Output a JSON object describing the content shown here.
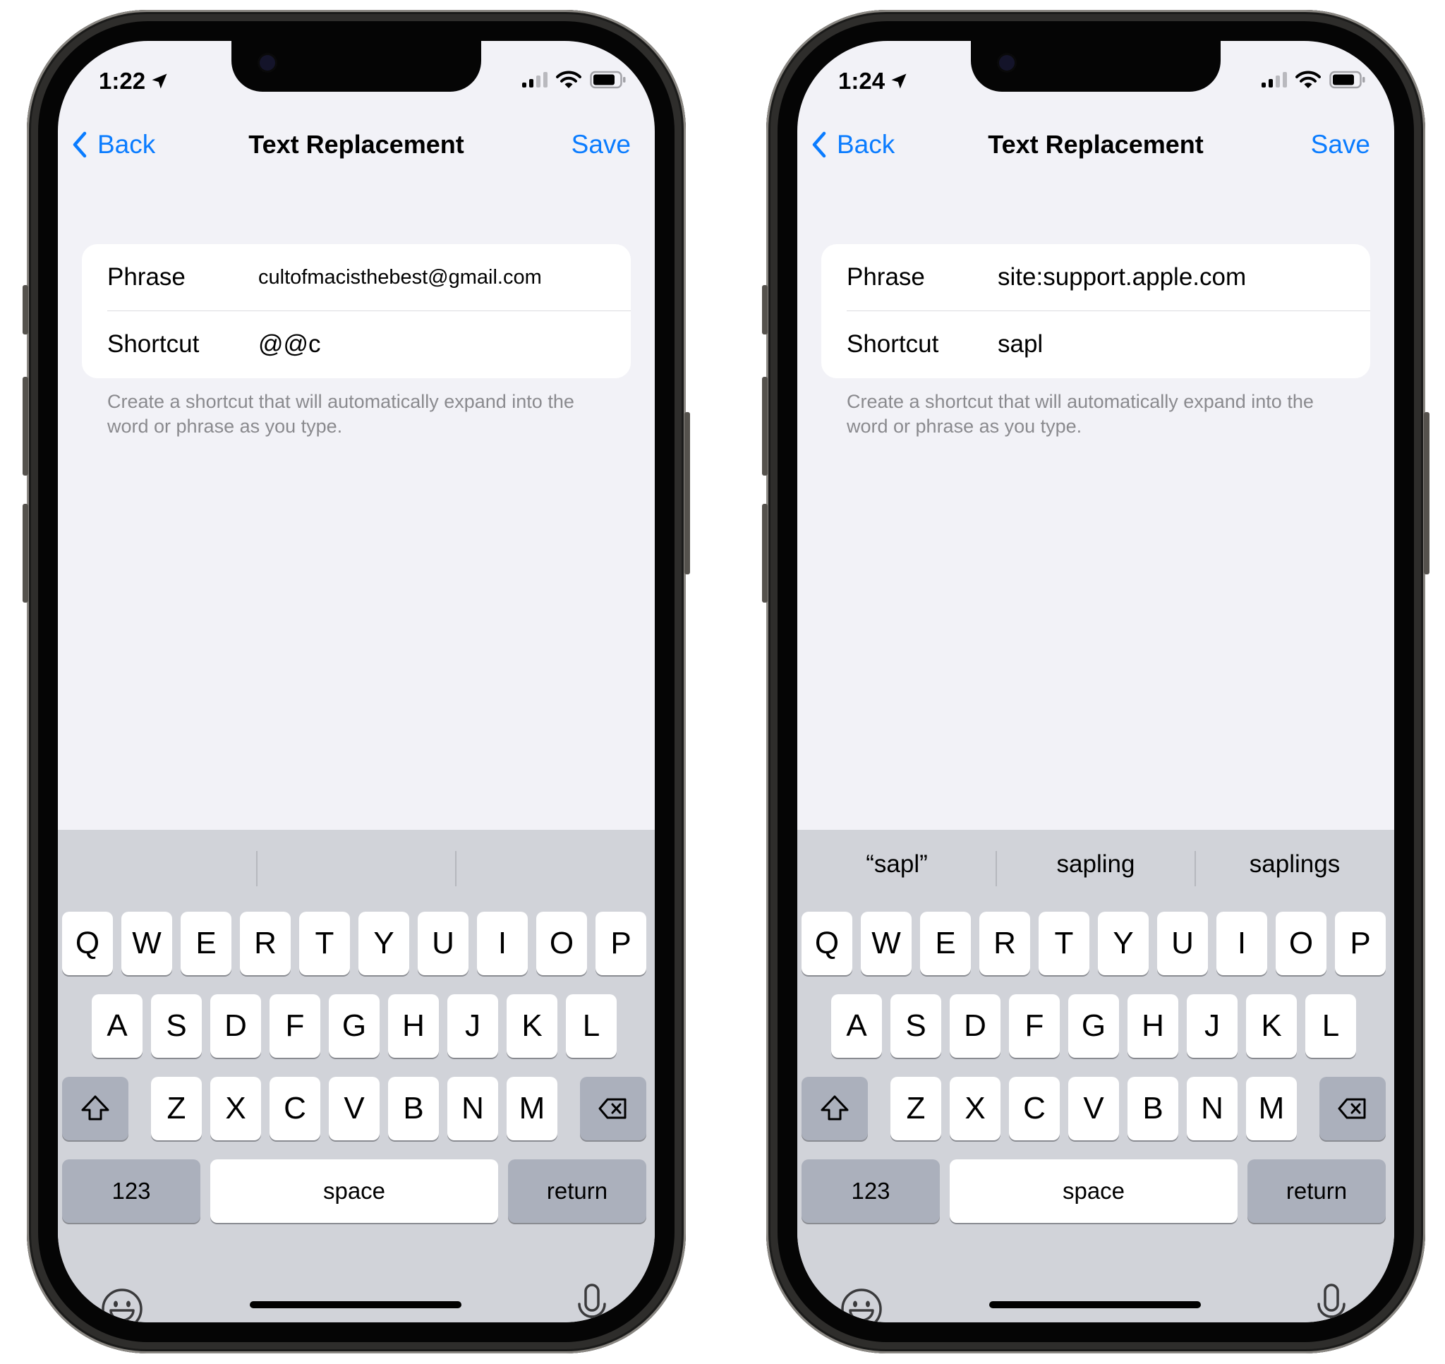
{
  "colors": {
    "accent": "#0a7cff",
    "background": "#f2f2f7",
    "keyboard": "#d1d3d9",
    "footnote": "#8a8a8e"
  },
  "phones": [
    {
      "status": {
        "time": "1:22",
        "icons": [
          "location-arrow-icon",
          "cellular-signal-icon",
          "wifi-icon",
          "battery-icon"
        ]
      },
      "nav": {
        "back": "Back",
        "title": "Text Replacement",
        "save": "Save"
      },
      "form": {
        "phrase_label": "Phrase",
        "phrase_value": "cultofmacisthebest@gmail.com",
        "shortcut_label": "Shortcut",
        "shortcut_value": "@@c"
      },
      "footnote": "Create a shortcut that will automatically expand into the word or phrase as you type.",
      "suggestions": [
        "",
        "",
        ""
      ],
      "keyboard": {
        "row1": [
          "Q",
          "W",
          "E",
          "R",
          "T",
          "Y",
          "U",
          "I",
          "O",
          "P"
        ],
        "row2": [
          "A",
          "S",
          "D",
          "F",
          "G",
          "H",
          "J",
          "K",
          "L"
        ],
        "row3": [
          "Z",
          "X",
          "C",
          "V",
          "B",
          "N",
          "M"
        ],
        "numbers": "123",
        "space": "space",
        "return": "return"
      }
    },
    {
      "status": {
        "time": "1:24",
        "icons": [
          "location-arrow-icon",
          "cellular-signal-icon",
          "wifi-icon",
          "battery-icon"
        ]
      },
      "nav": {
        "back": "Back",
        "title": "Text Replacement",
        "save": "Save"
      },
      "form": {
        "phrase_label": "Phrase",
        "phrase_value": "site:support.apple.com",
        "shortcut_label": "Shortcut",
        "shortcut_value": "sapl"
      },
      "footnote": "Create a shortcut that will automatically expand into the word or phrase as you type.",
      "suggestions": [
        "“sapl”",
        "sapling",
        "saplings"
      ],
      "keyboard": {
        "row1": [
          "Q",
          "W",
          "E",
          "R",
          "T",
          "Y",
          "U",
          "I",
          "O",
          "P"
        ],
        "row2": [
          "A",
          "S",
          "D",
          "F",
          "G",
          "H",
          "J",
          "K",
          "L"
        ],
        "row3": [
          "Z",
          "X",
          "C",
          "V",
          "B",
          "N",
          "M"
        ],
        "numbers": "123",
        "space": "space",
        "return": "return"
      }
    }
  ]
}
